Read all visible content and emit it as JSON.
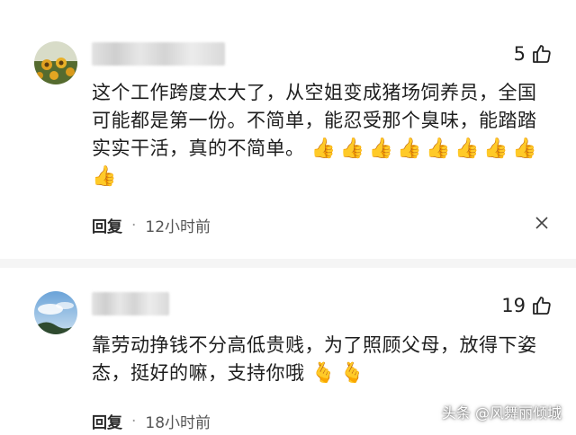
{
  "comments": [
    {
      "likes": "5",
      "text": "这个工作跨度太大了，从空姐变成猪场饲养员，全国可能都是第一份。不简单，能忍受那个臭味，能踏踏实实干活，真的不简单。",
      "emoji_count": 9,
      "emoji": "👍",
      "reply_label": "回复",
      "time": "12小时前"
    },
    {
      "likes": "19",
      "text": "靠劳动挣钱不分高低贵贱，为了照顾父母，放得下姿态，挺好的嘛，支持你哦",
      "emoji_count": 2,
      "emoji": "🫰",
      "reply_label": "回复",
      "time": "18小时前"
    }
  ],
  "watermark": "头条 @风舞丽倾城",
  "colors": {
    "text": "#1e1e1e",
    "meta": "#555555",
    "divider": "#f5f5f5"
  }
}
